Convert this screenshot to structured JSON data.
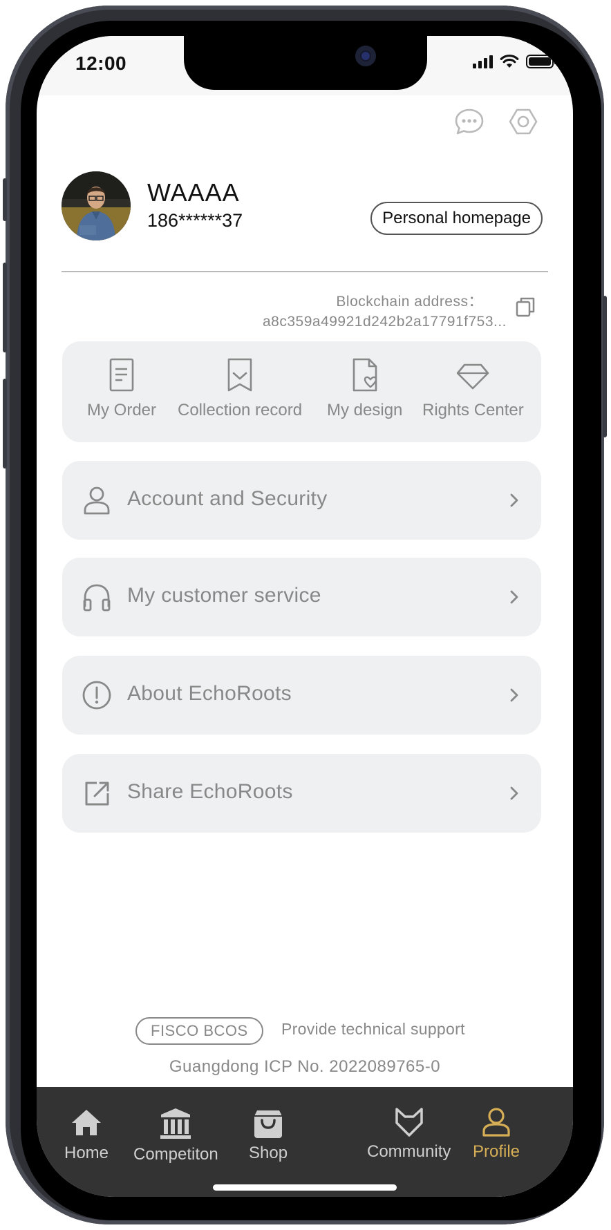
{
  "status_bar": {
    "time": "12:00"
  },
  "top_actions": {
    "message_icon": "chat-bubble-icon",
    "settings_icon": "hexagon-gear-icon"
  },
  "profile": {
    "name": "WAAAA",
    "phone": "186******37",
    "homepage_button": "Personal homepage"
  },
  "blockchain": {
    "label": "Blockchain address：",
    "address": "a8c359a49921d242b2a17791f753..."
  },
  "quick_actions": [
    {
      "label": "My Order",
      "icon": "document-icon"
    },
    {
      "label": "Collection record",
      "icon": "bookmark-icon"
    },
    {
      "label": "My design",
      "icon": "file-heart-icon"
    },
    {
      "label": "Rights Center",
      "icon": "diamond-icon"
    }
  ],
  "menu": [
    {
      "label": "Account and Security",
      "icon": "user-icon"
    },
    {
      "label": "My customer service",
      "icon": "headphones-icon"
    },
    {
      "label": "About EchoRoots",
      "icon": "info-circle-icon"
    },
    {
      "label": "Share EchoRoots",
      "icon": "share-external-icon"
    }
  ],
  "footer": {
    "badge": "FISCO BCOS",
    "support_text": "Provide technical support",
    "icp": "Guangdong ICP No. 2022089765-0"
  },
  "tabbar": {
    "active_color": "#d6ae55",
    "inactive_color": "#cfcfcf",
    "tabs": [
      {
        "label": "Home",
        "icon": "house-icon"
      },
      {
        "label": "Competiton",
        "icon": "museum-icon"
      },
      {
        "label": "Shop",
        "icon": "shopping-bag-icon"
      },
      {
        "label": "Community",
        "icon": "fox-head-icon"
      },
      {
        "label": "Profile",
        "icon": "person-icon",
        "active": true
      }
    ]
  }
}
